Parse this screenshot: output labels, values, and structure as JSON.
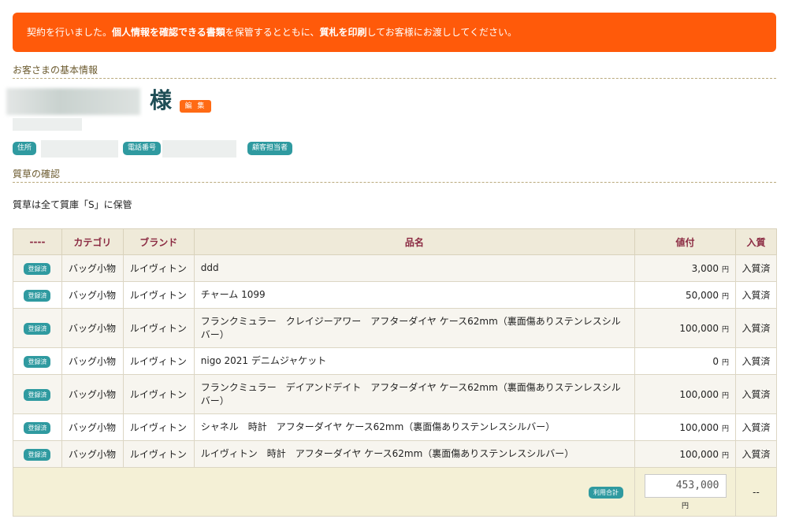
{
  "banner": {
    "part1": "契約を行いました。",
    "bold1": "個人情報を確認できる書類",
    "part2": "を保管するとともに、",
    "bold2": "質札を印刷",
    "part3": "してお客様にお渡ししてください。"
  },
  "customer": {
    "section_title": "お客さまの基本情報",
    "name_suffix": "様",
    "edit_label": "編 集",
    "address_tag": "住所",
    "phone_tag": "電話番号",
    "staff_tag": "顧客担当者"
  },
  "pawn": {
    "section_title": "質草の確認",
    "storage_text": "質草は全て質庫「S」に保管"
  },
  "table": {
    "headers": [
      "----",
      "カテゴリ",
      "ブランド",
      "品名",
      "値付",
      "入質"
    ],
    "rows": [
      {
        "badge": "登録済",
        "category": "バッグ小物",
        "brand": "ルイヴィトン",
        "name": "ddd",
        "price": "3,000",
        "yen": "円",
        "status": "入質済"
      },
      {
        "badge": "登録済",
        "category": "バッグ小物",
        "brand": "ルイヴィトン",
        "name": "チャーム 1099",
        "price": "50,000",
        "yen": "円",
        "status": "入質済"
      },
      {
        "badge": "登録済",
        "category": "バッグ小物",
        "brand": "ルイヴィトン",
        "name": "フランクミュラー　クレイジーアワー　アフターダイヤ ケース62mm（裏面傷ありステンレスシルバー）",
        "price": "100,000",
        "yen": "円",
        "status": "入質済"
      },
      {
        "badge": "登録済",
        "category": "バッグ小物",
        "brand": "ルイヴィトン",
        "name": "nigo 2021 デニムジャケット",
        "price": "0",
        "yen": "円",
        "status": "入質済"
      },
      {
        "badge": "登録済",
        "category": "バッグ小物",
        "brand": "ルイヴィトン",
        "name": "フランクミュラー　デイアンドデイト　アフターダイヤ ケース62mm（裏面傷ありステンレスシルバー）",
        "price": "100,000",
        "yen": "円",
        "status": "入質済"
      },
      {
        "badge": "登録済",
        "category": "バッグ小物",
        "brand": "ルイヴィトン",
        "name": "シャネル　時計　アフターダイヤ ケース62mm（裏面傷ありステンレスシルバー）",
        "price": "100,000",
        "yen": "円",
        "status": "入質済"
      },
      {
        "badge": "登録済",
        "category": "バッグ小物",
        "brand": "ルイヴィトン",
        "name": "ルイヴィトン　時計　アフターダイヤ ケース62mm（裏面傷ありステンレスシルバー）",
        "price": "100,000",
        "yen": "円",
        "status": "入質済"
      }
    ],
    "total_label": "利用合計",
    "total_value": "453,000",
    "total_yen": "円",
    "total_status": "--"
  },
  "colors": {
    "banner": "#ff5a0a",
    "badge": "#2f9aa0",
    "header_text": "#8b2a42",
    "header_bg": "#efead9"
  }
}
